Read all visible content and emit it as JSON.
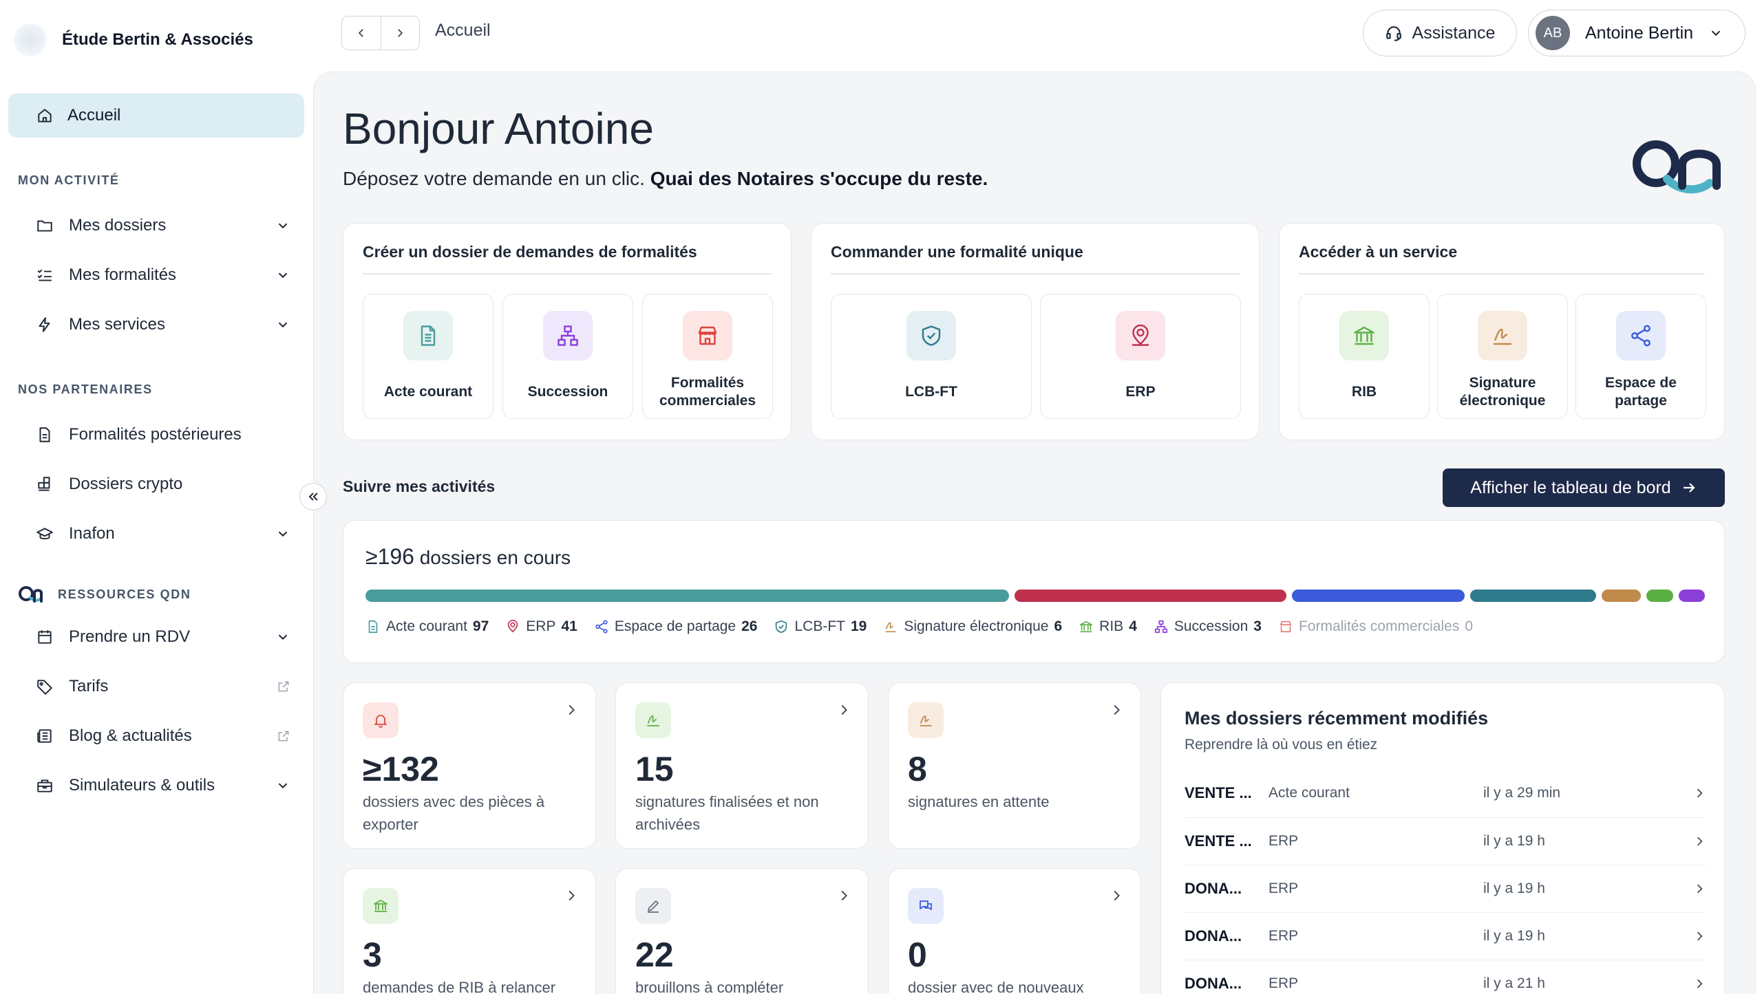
{
  "app": {
    "firm_name": "Étude Bertin & Associés"
  },
  "sidebar": {
    "home": "Accueil",
    "section_activity": "MON ACTIVITÉ",
    "activity_items": [
      {
        "label": "Mes dossiers",
        "icon": "folder-icon"
      },
      {
        "label": "Mes formalités",
        "icon": "checklist-icon"
      },
      {
        "label": "Mes services",
        "icon": "lightning-icon"
      }
    ],
    "section_partners": "NOS PARTENAIRES",
    "partner_items": [
      {
        "label": "Formalités postérieures",
        "icon": "document-icon"
      },
      {
        "label": "Dossiers crypto",
        "icon": "blocks-icon"
      },
      {
        "label": "Inafon",
        "icon": "graduation-cap-icon"
      }
    ],
    "section_resources": "RESSOURCES QDN",
    "resource_items": [
      {
        "label": "Prendre un RDV",
        "icon": "calendar-icon"
      },
      {
        "label": "Tarifs",
        "icon": "tag-icon"
      },
      {
        "label": "Blog & actualités",
        "icon": "newspaper-icon"
      },
      {
        "label": "Simulateurs & outils",
        "icon": "toolbox-icon"
      }
    ]
  },
  "header": {
    "breadcrumb": "Accueil",
    "assistance": "Assistance",
    "user_initials": "AB",
    "user_name": "Antoine Bertin"
  },
  "main": {
    "greeting": "Bonjour Antoine",
    "subtitle_plain": "Déposez votre demande en un clic.",
    "subtitle_bold": "Quai des Notaires s'occupe du reste.",
    "cards": [
      {
        "title": "Créer un dossier de demandes de formalités",
        "tiles": [
          {
            "label": "Acte courant",
            "icon": "document-icon"
          },
          {
            "label": "Succession",
            "icon": "hierarchy-icon"
          },
          {
            "label": "Formalités commerciales",
            "icon": "store-icon"
          }
        ]
      },
      {
        "title": "Commander une formalité unique",
        "tiles": [
          {
            "label": "LCB-FT",
            "icon": "shield-check-icon"
          },
          {
            "label": "ERP",
            "icon": "map-pin-user-icon"
          }
        ]
      },
      {
        "title": "Accéder à un service",
        "tiles": [
          {
            "label": "RIB",
            "icon": "bank-icon"
          },
          {
            "label": "Signature électronique",
            "icon": "signature-icon"
          },
          {
            "label": "Espace de partage",
            "icon": "share-icon"
          }
        ]
      }
    ],
    "follow_title": "Suivre mes activités",
    "dashboard_button": "Afficher le tableau de bord",
    "progress": {
      "count": "≥196",
      "label": "dossiers en cours",
      "legend": [
        {
          "label": "Acte courant",
          "value": "97",
          "color": "#4a9b9b"
        },
        {
          "label": "ERP",
          "value": "41",
          "color": "#c0304f"
        },
        {
          "label": "Espace de partage",
          "value": "26",
          "color": "#3b5bdb"
        },
        {
          "label": "LCB-FT",
          "value": "19",
          "color": "#2f7a8c"
        },
        {
          "label": "Signature électronique",
          "value": "6",
          "color": "#c08a4a"
        },
        {
          "label": "RIB",
          "value": "4",
          "color": "#5bb043"
        },
        {
          "label": "Succession",
          "value": "3",
          "color": "#8b3fd9"
        },
        {
          "label": "Formalités commerciales",
          "value": "0",
          "color": "#e07a6a"
        }
      ]
    },
    "stats": [
      {
        "value": "≥132",
        "label": "dossiers avec des pièces à exporter",
        "icon": "bell-icon"
      },
      {
        "value": "15",
        "label": "signatures finalisées et non archivées",
        "icon": "signature-icon"
      },
      {
        "value": "8",
        "label": "signatures en attente",
        "icon": "signature-icon"
      },
      {
        "value": "3",
        "label": "demandes de RIB à relancer",
        "icon": "bank-icon"
      },
      {
        "value": "22",
        "label": "brouillons à compléter",
        "icon": "pencil-icon"
      },
      {
        "value": "0",
        "label": "dossier avec de nouveaux",
        "icon": "chat-bubbles-icon"
      }
    ],
    "recent": {
      "title": "Mes dossiers récemment modifiés",
      "subtitle": "Reprendre là où vous en étiez",
      "rows": [
        {
          "name": "VENTE ...",
          "type": "Acte courant",
          "date": "il y a 29 min"
        },
        {
          "name": "VENTE ...",
          "type": "ERP",
          "date": "il y a 19 h"
        },
        {
          "name": "DONA...",
          "type": "ERP",
          "date": "il y a 19 h"
        },
        {
          "name": "DONA...",
          "type": "ERP",
          "date": "il y a 19 h"
        },
        {
          "name": "DONA...",
          "type": "ERP",
          "date": "il y a 21 h"
        }
      ]
    }
  }
}
